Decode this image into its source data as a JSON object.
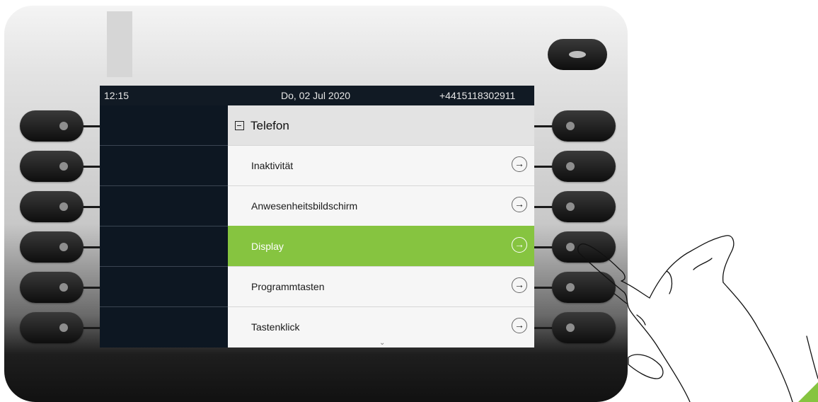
{
  "status": {
    "time": "12:15",
    "date": "Do, 02 Jul 2020",
    "number": "+4415118302911"
  },
  "menu": {
    "title": "Telefon",
    "items": [
      {
        "label": "Inaktivität",
        "selected": false
      },
      {
        "label": "Anwesenheitsbildschirm",
        "selected": false
      },
      {
        "label": "Display",
        "selected": true
      },
      {
        "label": "Programmtasten",
        "selected": false
      },
      {
        "label": "Tastenklick",
        "selected": false
      }
    ],
    "scroll_indicator": "⌄"
  },
  "icons": {
    "collapse": "minus-box-icon",
    "item_action": "arrow-right-circle-icon",
    "arrow_glyph": "→"
  },
  "colors": {
    "selected": "#86c440",
    "screen_bg": "#0d1722"
  }
}
